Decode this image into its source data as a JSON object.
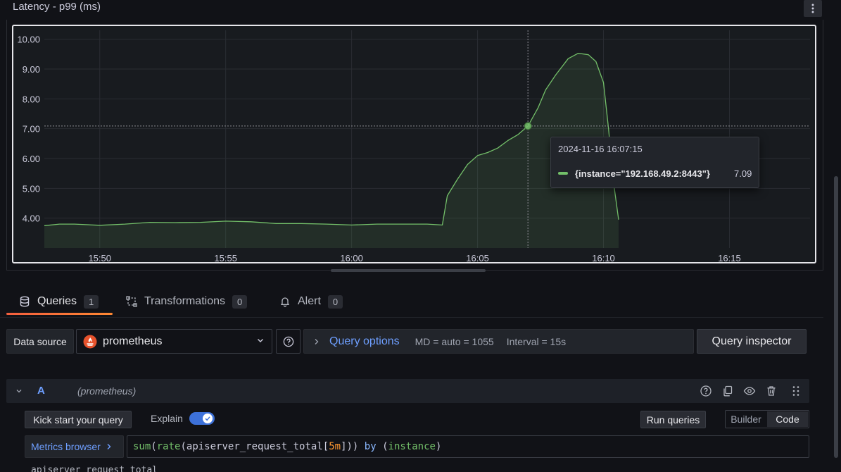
{
  "panel": {
    "title": "Latency - p99 (ms)",
    "menu_icon": "vertical-dots-icon"
  },
  "chart_data": {
    "type": "line",
    "ylim": [
      3.0,
      10.3
    ],
    "yticks": [
      "10.00",
      "9.00",
      "8.00",
      "7.00",
      "6.00",
      "5.00",
      "4.00"
    ],
    "ytick_values": [
      10,
      9,
      8,
      7,
      6,
      5,
      4
    ],
    "xlim_minutes": [
      -2.2,
      28.2
    ],
    "xticks": [
      "15:50",
      "15:55",
      "16:00",
      "16:05",
      "16:10",
      "16:15"
    ],
    "xtick_values": [
      0,
      5,
      10,
      15,
      20,
      25
    ],
    "grid": true,
    "series": [
      {
        "name": "{instance=\"192.168.49.2:8443\"}",
        "color": "#73bf69",
        "x": [
          -2.2,
          -1.6,
          -1.0,
          0.0,
          1.0,
          2.0,
          3.0,
          4.0,
          5.0,
          6.0,
          7.0,
          8.0,
          9.0,
          10.0,
          11.0,
          12.0,
          13.0,
          13.6,
          13.8,
          14.2,
          14.6,
          15.0,
          15.4,
          15.8,
          16.2,
          16.6,
          17.0,
          17.4,
          17.7,
          18.1,
          18.6,
          19.0,
          19.4,
          19.7,
          20.0,
          20.2,
          20.4,
          20.6
        ],
        "values": [
          3.75,
          3.8,
          3.8,
          3.76,
          3.8,
          3.86,
          3.85,
          3.86,
          3.9,
          3.88,
          3.82,
          3.82,
          3.8,
          3.77,
          3.8,
          3.8,
          3.8,
          3.77,
          4.75,
          5.3,
          5.8,
          6.1,
          6.2,
          6.35,
          6.6,
          6.8,
          7.09,
          7.7,
          8.3,
          8.8,
          9.35,
          9.53,
          9.48,
          9.25,
          8.55,
          7.0,
          5.2,
          3.95
        ]
      }
    ],
    "crosshair": {
      "x": 17.0,
      "y": 7.09
    }
  },
  "tooltip": {
    "time": "2024-11-16 16:07:15",
    "series": "{instance=\"192.168.49.2:8443\"}",
    "value": "7.09"
  },
  "tabs": [
    {
      "label": "Queries",
      "count": "1",
      "icon": "database-icon"
    },
    {
      "label": "Transformations",
      "count": "0",
      "icon": "transform-icon"
    },
    {
      "label": "Alert",
      "count": "0",
      "icon": "bell-icon"
    }
  ],
  "datasource": {
    "label": "Data source",
    "selected": "prometheus",
    "query_options": "Query options",
    "md": "MD = auto = 1055",
    "interval": "Interval = 15s",
    "inspector": "Query inspector"
  },
  "query": {
    "letter": "A",
    "datasource": "(prometheus)",
    "kick_start": "Kick start your query",
    "explain": "Explain",
    "explain_on": true,
    "run": "Run queries",
    "mode_builder": "Builder",
    "mode_code": "Code",
    "metrics_browser": "Metrics browser",
    "expr_tokens": [
      "sum",
      "(",
      "rate",
      "(",
      "apiserver_request_total",
      "[",
      "5m",
      "]",
      "))",
      " by ",
      "(",
      "instance",
      ")"
    ],
    "cut_text": "apiserver_request_total"
  },
  "colors": {
    "accent": "#6e9fff",
    "series": "#73bf69",
    "tab_underline": "#f55f3e"
  }
}
